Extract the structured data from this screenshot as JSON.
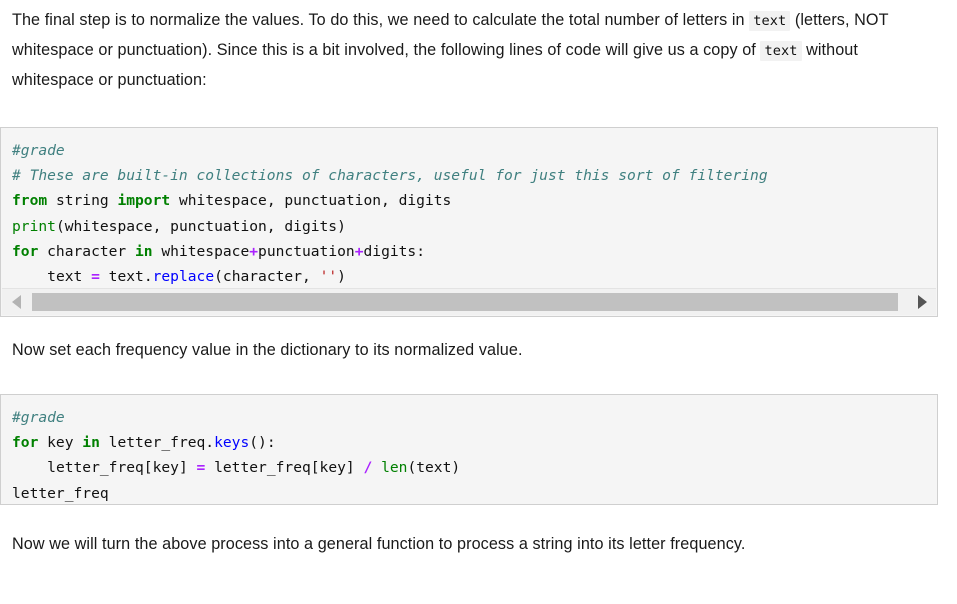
{
  "document": {
    "paragraph_intro": {
      "seg1": "The final step is to normalize the values. To do this, we need to calculate the total number of letters in ",
      "code1": "text",
      "seg2": " (letters, NOT whitespace or punctuation). Since this is a bit involved, the following lines of code will give us a copy of ",
      "code2": "text",
      "seg3": " without whitespace or punctuation:"
    },
    "paragraph_middle": "Now set each frequency value in the dictionary to its normalized value.",
    "paragraph_end": "Now we will turn the above process into a general function to process a string into its letter frequency."
  },
  "code_cell_1": {
    "line1_comment": "#grade",
    "line2_comment": "# These are built-in collections of characters, useful for just this sort of filtering",
    "line3": {
      "kw_from": "from",
      "module": " string ",
      "kw_import": "import",
      "rest": " whitespace, punctuation, digits"
    },
    "line4": {
      "builtin": "print",
      "rest": "(whitespace, punctuation, digits)"
    },
    "line5": {
      "kw_for": "for",
      "var": " character ",
      "kw_in": "in",
      "a": " whitespace",
      "op1": "+",
      "b": "punctuation",
      "op2": "+",
      "c": "digits:"
    },
    "line6": {
      "indent": "    ",
      "lhs": "text ",
      "eq": "=",
      "obj": " text.",
      "method": "replace",
      "open": "(character, ",
      "str": "''",
      "close": ")"
    },
    "scrollbar": {
      "left_arrow": "scroll-left",
      "right_arrow": "scroll-right",
      "orientation": "horizontal"
    }
  },
  "code_cell_2": {
    "line1_comment": "#grade",
    "line2": {
      "kw_for": "for",
      "var": " key ",
      "kw_in": "in",
      "obj": " letter_freq.",
      "method": "keys",
      "rest": "():"
    },
    "line3": {
      "indent": "    ",
      "lhs": "letter_freq[key] ",
      "eq": "=",
      "mid": " letter_freq[key] ",
      "div": "/",
      "sp": " ",
      "builtin": "len",
      "rest": "(text)"
    },
    "line4": "letter_freq"
  },
  "colors": {
    "keyword": "#008000",
    "comment": "#408080",
    "function": "#0000ff",
    "operator": "#aa22ff",
    "string": "#ba2121",
    "code_background": "#f5f5f5",
    "code_border": "#cfcfcf",
    "inline_code_background": "#f2f2f2",
    "scrollbar_thumb": "#c1c1c1",
    "text": "#1a1a1a",
    "page_background": "#ffffff"
  }
}
